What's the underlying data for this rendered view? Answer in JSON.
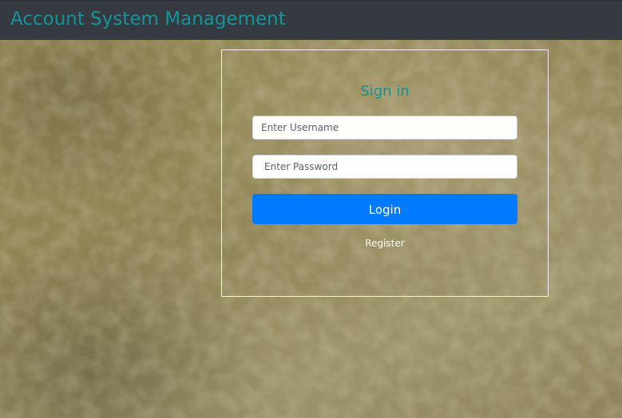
{
  "header": {
    "title": "Account System Management"
  },
  "login": {
    "title": "Sign in",
    "username_placeholder": "Enter Username",
    "username_value": "",
    "password_placeholder": "Enter Password",
    "password_value": "",
    "login_label": "Login",
    "register_label": "Register"
  },
  "colors": {
    "navbar_bg": "#343a40",
    "brand": "#14939a",
    "primary_button": "#007bff",
    "box_border": "#f2f2f2"
  }
}
